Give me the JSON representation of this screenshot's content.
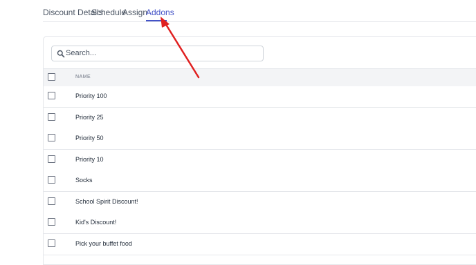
{
  "tabs": [
    {
      "label": "Discount Details",
      "active": false
    },
    {
      "label": "Schedule",
      "active": false
    },
    {
      "label": "Assign",
      "active": false
    },
    {
      "label": "Addons",
      "active": true
    }
  ],
  "search": {
    "placeholder": "Search...",
    "value": ""
  },
  "table": {
    "header": {
      "name": "NAME"
    },
    "rows": [
      {
        "name": "Priority 100"
      },
      {
        "name": "Priority 25"
      },
      {
        "name": "Priority 50"
      },
      {
        "name": "Priority 10"
      },
      {
        "name": "Socks"
      },
      {
        "name": "School Spirit Discount!"
      },
      {
        "name": "Kid's Discount!"
      },
      {
        "name": "Pick your buffet food"
      }
    ]
  },
  "colors": {
    "accent": "#4453c7",
    "annotation_arrow": "#e02020"
  },
  "icons": {
    "search": "search-icon",
    "annotation": "red-arrow"
  }
}
